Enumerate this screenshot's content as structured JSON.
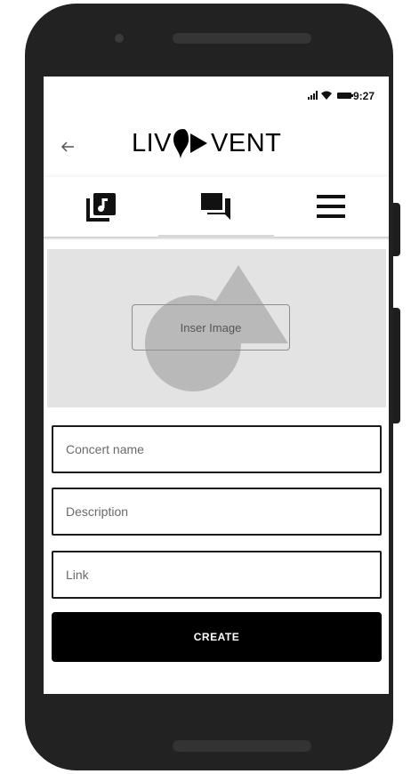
{
  "status_bar": {
    "time": "9:27",
    "icons": [
      "signal-icon",
      "wifi-icon",
      "battery-icon"
    ]
  },
  "header": {
    "back_icon": "arrow-left-icon",
    "logo_text_left": "LIV",
    "logo_text_right": "VENT"
  },
  "tabs": [
    {
      "icon": "music-library-icon",
      "active": false
    },
    {
      "icon": "chat-icon",
      "active": true
    },
    {
      "icon": "menu-icon",
      "active": false
    }
  ],
  "image_upload": {
    "button_label": "Inser Image"
  },
  "form": {
    "concert_name_placeholder": "Concert name",
    "description_placeholder": "Description",
    "link_placeholder": "Link",
    "submit_label": "CREATE"
  },
  "colors": {
    "primary": "#000000",
    "placeholder_bg": "#e3e3e3",
    "phone_body": "#222222"
  }
}
